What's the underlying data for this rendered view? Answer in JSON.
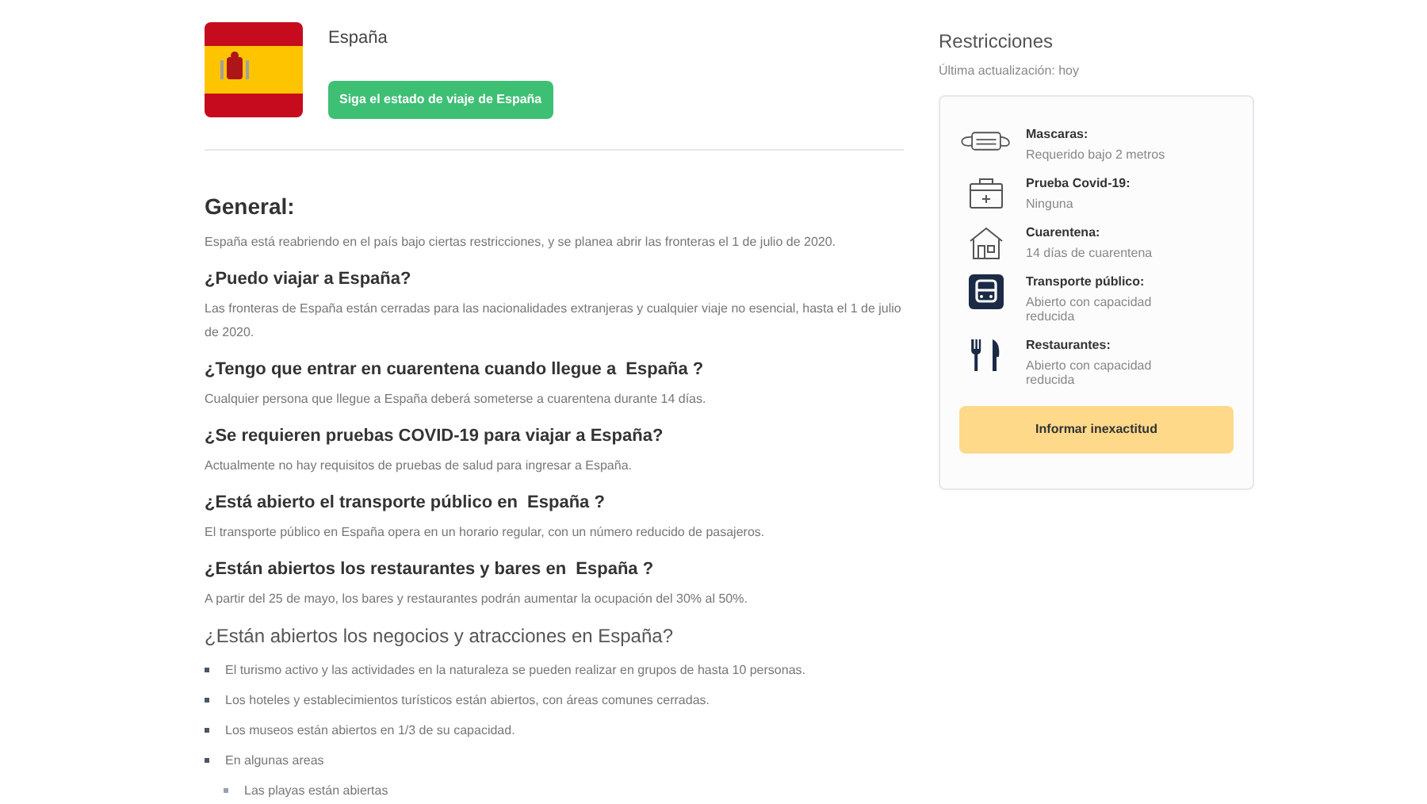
{
  "country": {
    "name": "España",
    "follow_button": "Siga el estado de viaje de España"
  },
  "general": {
    "heading": "General:",
    "text": "España está reabriendo en el país bajo ciertas restricciones, y se planea abrir las fronteras el 1 de julio de 2020."
  },
  "questions": [
    {
      "question": "¿Puedo viajar a España?",
      "answer": "Las fronteras de España están cerradas para las nacionalidades extranjeras y cualquier viaje no esencial, hasta el 1 de julio de 2020."
    },
    {
      "question": "¿Tengo que entrar en cuarentena cuando llegue a  España ?",
      "answer": "Cualquier persona que llegue a España deberá someterse a cuarentena durante 14 días."
    },
    {
      "question": "¿Se requieren pruebas COVID-19 para viajar a España?",
      "answer": "Actualmente no hay requisitos de pruebas de salud para ingresar a España."
    },
    {
      "question": "¿Está abierto el transporte público en  España ?",
      "answer": "El transporte público en España opera en un horario regular, con un número reducido de pasajeros."
    },
    {
      "question": "¿Están abiertos los restaurantes y bares en  España ?",
      "answer": "A partir del 25 de mayo, los bares y restaurantes podrán aumentar la ocupación del 30% al 50%."
    }
  ],
  "businesses": {
    "heading": "¿Están abiertos los negocios y atracciones en España?",
    "items": [
      {
        "text": "El turismo activo y las actividades en la naturaleza se pueden realizar en grupos de hasta 10 personas."
      },
      {
        "text": "Los hoteles y establecimientos turísticos están abiertos, con áreas comunes cerradas."
      },
      {
        "text": "Los museos están abiertos en 1/3 de su capacidad."
      },
      {
        "text": "En algunas areas",
        "children": [
          {
            "text": "Las playas están abiertas"
          }
        ]
      }
    ]
  },
  "restrictions": {
    "title": "Restricciones",
    "updated": "Última actualización: hoy",
    "items": [
      {
        "kind": "mask",
        "label": "Mascaras:",
        "value": "Requerido bajo 2 metros"
      },
      {
        "kind": "test",
        "label": "Prueba Covid-19:",
        "value": "Ninguna"
      },
      {
        "kind": "house",
        "label": "Cuarentena:",
        "value": "14 días de cuarentena"
      },
      {
        "kind": "bus",
        "label": "Transporte público:",
        "value": "Abierto con capacidad reducida"
      },
      {
        "kind": "food",
        "label": "Restaurantes:",
        "value": "Abierto con capacidad reducida"
      }
    ],
    "report_button": "Informar inexactitud"
  }
}
